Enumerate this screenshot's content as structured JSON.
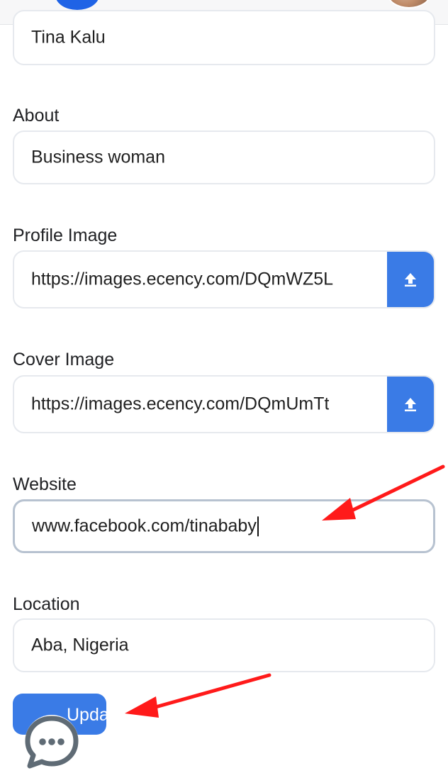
{
  "profile_form": {
    "name": {
      "value": "Tina Kalu"
    },
    "about": {
      "label": "About",
      "value": "Business woman"
    },
    "profile_image": {
      "label": "Profile Image",
      "value": "https://images.ecency.com/DQmWZ5L"
    },
    "cover_image": {
      "label": "Cover Image",
      "value": "https://images.ecency.com/DQmUmTt"
    },
    "website": {
      "label": "Website",
      "value": "www.facebook.com/tinababy"
    },
    "location": {
      "label": "Location",
      "value": "Aba, Nigeria"
    },
    "update_label": "Update"
  },
  "icons": {
    "upload": "upload-icon",
    "chat": "chat-bubble-icon"
  },
  "colors": {
    "accent": "#3a7be6",
    "annotation": "#ff1a1a",
    "input_border": "#e6e9ee"
  }
}
